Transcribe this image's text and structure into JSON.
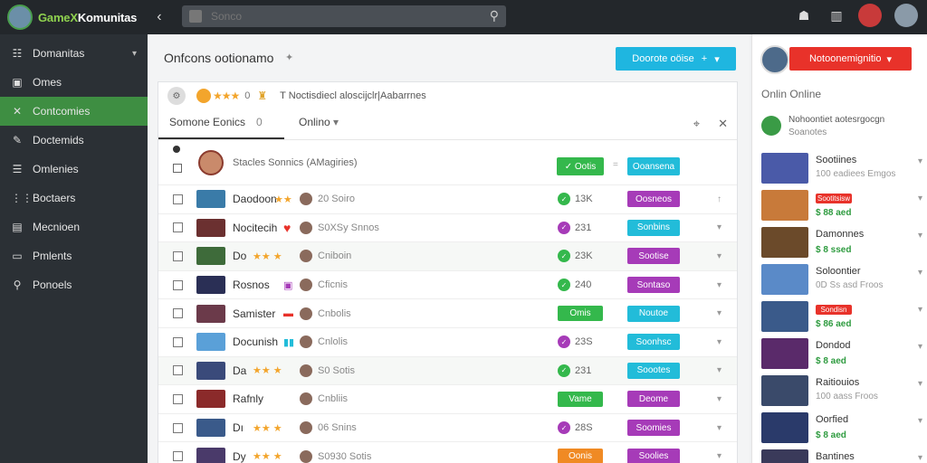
{
  "topbar": {
    "brand_prefix": "GameX",
    "brand_suffix": "Komunitas",
    "search_placeholder": "Sonco"
  },
  "sidebar": {
    "items": [
      {
        "label": "Domanitas",
        "icon": "☷",
        "has_chevron": true
      },
      {
        "label": "Omes",
        "icon": "▣"
      },
      {
        "label": "Contcomies",
        "icon": "✕",
        "active": true
      },
      {
        "label": "Doctemids",
        "icon": "✎"
      },
      {
        "label": "Omlenies",
        "icon": "☰"
      },
      {
        "label": "Boctaers",
        "icon": "⋮⋮"
      },
      {
        "label": "Mecnioen",
        "icon": "▤"
      },
      {
        "label": "Pmlents",
        "icon": "▭"
      },
      {
        "label": "Ponoels",
        "icon": "⚲"
      }
    ]
  },
  "main": {
    "title": "Onfcons ootionamo",
    "primary_button": "Doorote oöise",
    "panel_head_count": "0",
    "panel_head_text": "T Noctisdiecl aloscijclr|Aabarrnes",
    "tabs": [
      {
        "label": "Somone Eonics",
        "count": "0"
      },
      {
        "label": "Onlino"
      }
    ],
    "header_row": {
      "label": "Stacles Sonnics (AMagiries)",
      "green_pill": "Ootis",
      "cyan_pill": "Ooansena"
    },
    "rows": [
      {
        "name": "Daodoon",
        "cat": "20 Soiro",
        "status": "13K",
        "status_color": "#34b84c",
        "action": "Oosneos",
        "action_color": "#a63bb8",
        "shaded": false,
        "thumb": "#3a7ba8",
        "tag": "stars"
      },
      {
        "name": "Nocitecih",
        "cat": "S0XSy Snnos",
        "status": "231",
        "status_color": "#a63bb8",
        "action": "Sonbins",
        "action_color": "#22bcd9",
        "shaded": false,
        "thumb": "#6b3030",
        "tag": "heart"
      },
      {
        "name": "Do",
        "cat": "Cniboin",
        "status": "23K",
        "status_color": "#34b84c",
        "action": "Sootise",
        "action_color": "#a63bb8",
        "shaded": true,
        "thumb": "#3e6b3a",
        "tag": "stars2"
      },
      {
        "name": "Rosnos",
        "cat": "Cficnis",
        "status": "240",
        "status_color": "#34b84c",
        "action": "Sontaso",
        "action_color": "#a63bb8",
        "shaded": false,
        "thumb": "#2a2f55",
        "tag": "box"
      },
      {
        "name": "Samister",
        "cat": "Cnbolis",
        "status": "Omis",
        "status_color": "#34b84c",
        "action": "Noutoe",
        "action_color": "#22bcd9",
        "shaded": false,
        "thumb": "#6b3a4a",
        "tag": "redbox",
        "status_pill": true
      },
      {
        "name": "Docunish",
        "cat": "Cnlolis",
        "status": "23S",
        "status_color": "#a63bb8",
        "action": "Soonhsc",
        "action_color": "#22bcd9",
        "shaded": false,
        "thumb": "#5aa0d8",
        "tag": "blue"
      },
      {
        "name": "Da",
        "cat": "S0 Sotis",
        "status": "231",
        "status_color": "#34b84c",
        "action": "Soootes",
        "action_color": "#22bcd9",
        "shaded": true,
        "thumb": "#3a4a7a",
        "tag": "stars2"
      },
      {
        "name": "Rafnly",
        "cat": "Cnbliis",
        "status": "Vame",
        "status_color": "#34b84c",
        "action": "Deome",
        "action_color": "#a63bb8",
        "shaded": false,
        "thumb": "#8b2a2a",
        "tag": "",
        "status_pill": true
      },
      {
        "name": "Dı",
        "cat": "06 Snins",
        "status": "28S",
        "status_color": "#a63bb8",
        "action": "Soomies",
        "action_color": "#a63bb8",
        "shaded": false,
        "thumb": "#3a5a8a",
        "tag": "stars2"
      },
      {
        "name": "Dy",
        "cat": "S0930 Sotis",
        "status": "Oonis",
        "status_color": "#f08a24",
        "action": "Soolies",
        "action_color": "#a63bb8",
        "shaded": false,
        "thumb": "#4a3a6a",
        "tag": "stars2",
        "status_pill": true
      }
    ]
  },
  "rightbar": {
    "button": "Notoonemignitio",
    "online": "Onlin Online",
    "user": {
      "name": "Nohoontiet aotesrgocgn",
      "sub": "Soanotes"
    },
    "cards": [
      {
        "title": "Sootiines",
        "sub": "100 eadiees Emgos",
        "thumb": "#4a5aa8"
      },
      {
        "badge": "Sootitsisw",
        "price": "$ 88 aed",
        "thumb": "#c87a3a"
      },
      {
        "title": "Damonnes",
        "price": "$ 8 ssed",
        "thumb": "#6b4a2a"
      },
      {
        "title": "Soloontier",
        "sub": "0D Ss asd Froos",
        "thumb": "#5a8ac8"
      },
      {
        "badge": "Sondisn",
        "price": "$ 86 aed",
        "thumb": "#3a5a8a"
      },
      {
        "title": "Dondod",
        "price": "$ 8 aed",
        "thumb": "#5a2a6a"
      },
      {
        "title": "Raitiouios",
        "sub": "100 aass Froos",
        "thumb": "#3a4a6a"
      },
      {
        "title": "Oorfied",
        "price": "$ 8 aed",
        "thumb": "#2a3a6a"
      },
      {
        "title": "Bantines",
        "thumb": "#3a3a5a"
      }
    ]
  }
}
